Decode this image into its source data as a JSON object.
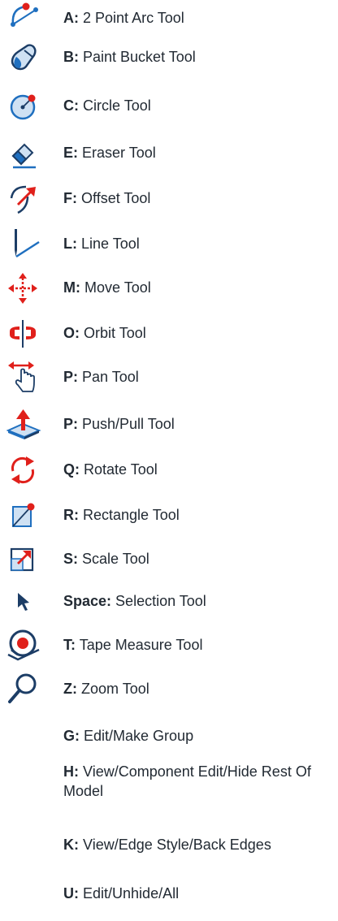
{
  "shortcuts": [
    {
      "key": "A:",
      "label": "2 Point Arc Tool",
      "icon": "two-point-arc-icon"
    },
    {
      "key": "B:",
      "label": "Paint Bucket Tool",
      "icon": "paint-bucket-icon"
    },
    {
      "key": "C:",
      "label": "Circle Tool",
      "icon": "circle-icon"
    },
    {
      "key": "E:",
      "label": "Eraser Tool",
      "icon": "eraser-icon"
    },
    {
      "key": "F:",
      "label": "Offset Tool",
      "icon": "offset-icon"
    },
    {
      "key": "L:",
      "label": "Line Tool",
      "icon": "line-icon"
    },
    {
      "key": "M:",
      "label": "Move Tool",
      "icon": "move-icon"
    },
    {
      "key": "O:",
      "label": "Orbit Tool",
      "icon": "orbit-icon"
    },
    {
      "key": "P:",
      "label": "Pan Tool",
      "icon": "pan-icon"
    },
    {
      "key": "P:",
      "label": "Push/Pull Tool",
      "icon": "push-pull-icon"
    },
    {
      "key": "Q:",
      "label": "Rotate Tool",
      "icon": "rotate-icon"
    },
    {
      "key": "R:",
      "label": "Rectangle Tool",
      "icon": "rectangle-icon"
    },
    {
      "key": "S:",
      "label": "Scale Tool",
      "icon": "scale-icon"
    },
    {
      "key": "Space:",
      "label": "Selection Tool",
      "icon": "selection-arrow-icon"
    },
    {
      "key": "T:",
      "label": "Tape Measure Tool",
      "icon": "tape-measure-icon"
    },
    {
      "key": "Z:",
      "label": "Zoom Tool",
      "icon": "zoom-icon"
    }
  ],
  "commands": [
    {
      "key": "G:",
      "label": "Edit/Make Group"
    },
    {
      "key": "H:",
      "label": "View/Component Edit/Hide Rest Of Model"
    },
    {
      "key": "K:",
      "label": "View/Edge Style/Back Edges"
    },
    {
      "key": "U:",
      "label": "Edit/Unhide/All"
    }
  ],
  "colors": {
    "icon_blue": "#1f6fbf",
    "icon_dark": "#1c3d66",
    "icon_red": "#e0201b",
    "icon_light": "#cfe1f3",
    "text": "#222a33"
  }
}
